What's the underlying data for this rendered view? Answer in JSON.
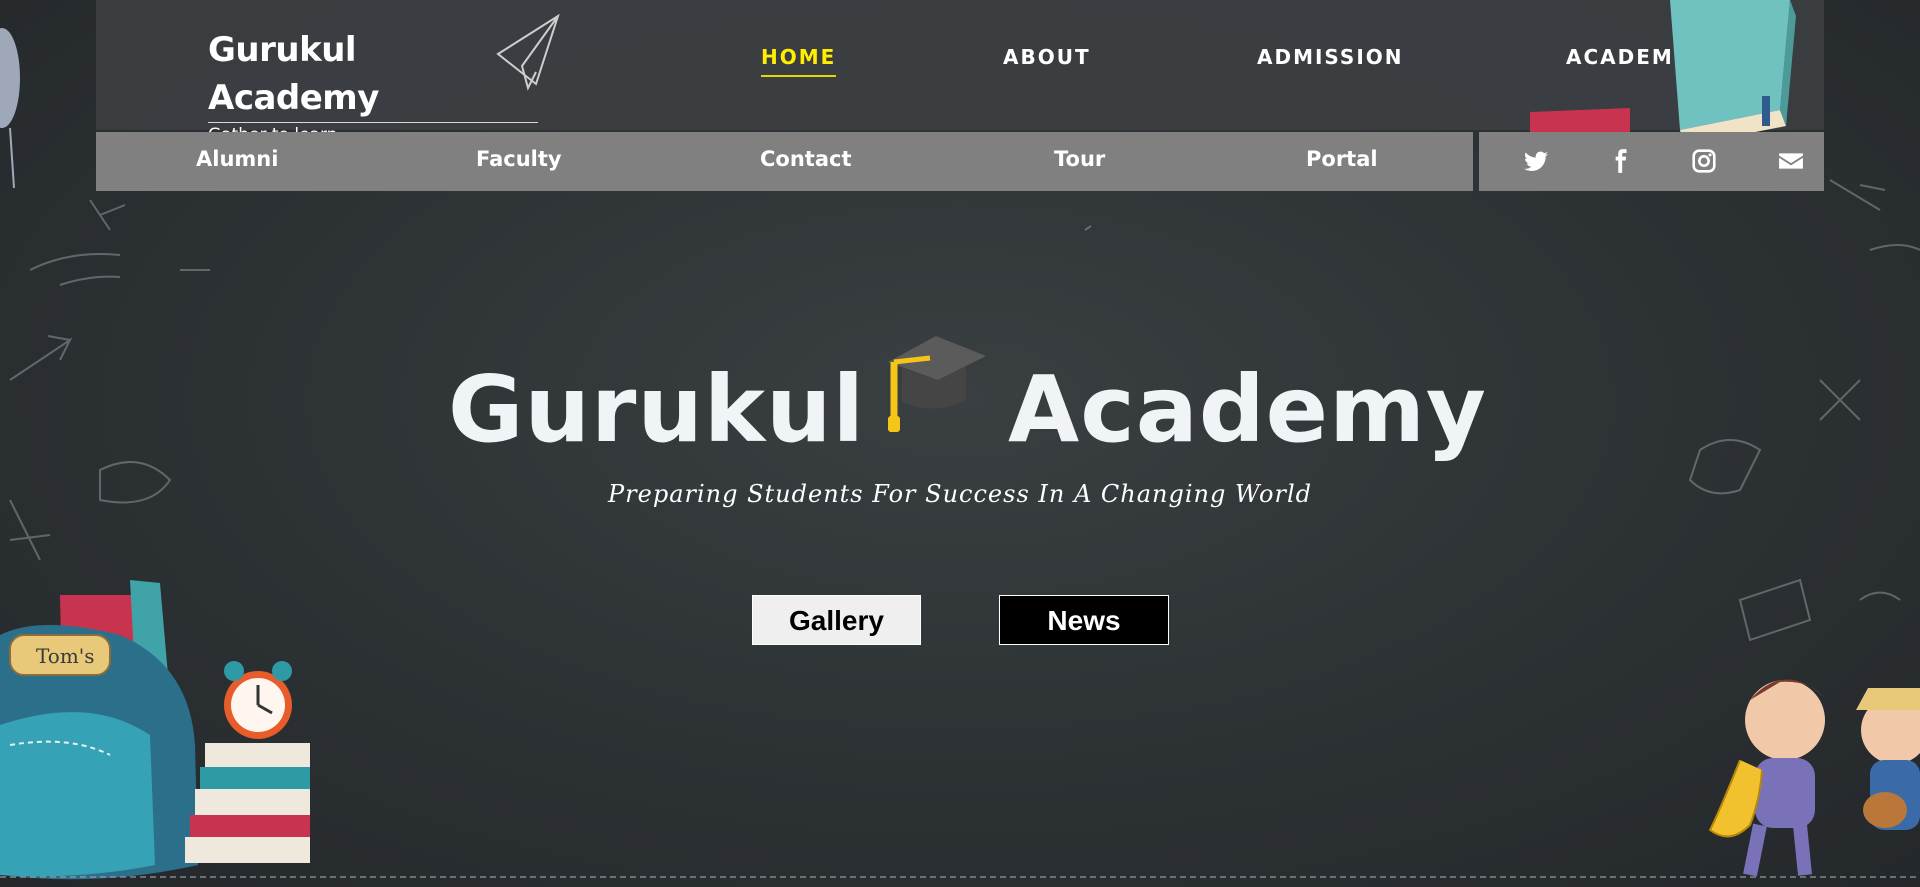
{
  "brand": {
    "title": "Gurukul Academy",
    "tagline": "Gather to learn"
  },
  "nav_main": [
    {
      "label": "HOME",
      "active": true
    },
    {
      "label": "ABOUT",
      "active": false
    },
    {
      "label": "ADMISSION",
      "active": false
    },
    {
      "label": "ACADEMICS",
      "active": false
    }
  ],
  "nav_secondary": [
    {
      "label": "Alumni"
    },
    {
      "label": "Faculty"
    },
    {
      "label": "Contact"
    },
    {
      "label": "Tour"
    },
    {
      "label": "Portal"
    }
  ],
  "social": [
    {
      "icon": "twitter-icon"
    },
    {
      "icon": "facebook-icon"
    },
    {
      "icon": "instagram-icon"
    },
    {
      "icon": "envelope-icon"
    }
  ],
  "hero": {
    "title_word_1": "Gurukul",
    "title_word_2": "Academy",
    "subtitle": "Preparing Students For Success In A Changing World",
    "gallery_button": "Gallery",
    "news_button": "News"
  },
  "decorations": {
    "backpack_tag": "Tom's"
  },
  "colors": {
    "active_nav": "#ffee00",
    "subnav_bg": "#808080",
    "cap_tassel": "#f5c518",
    "board": "#2c3134"
  }
}
